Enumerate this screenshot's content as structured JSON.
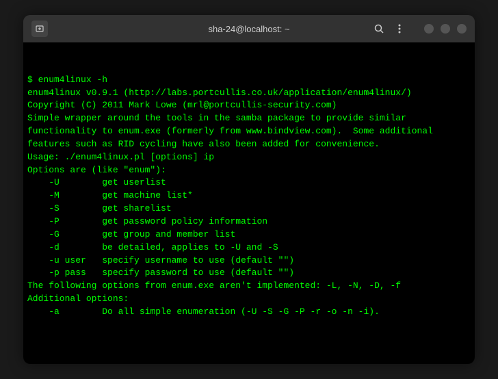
{
  "titlebar": {
    "title": "sha-24@localhost: ~"
  },
  "terminal": {
    "lines": [
      "$ enum4linux -h",
      "enum4linux v0.9.1 (http://labs.portcullis.co.uk/application/enum4linux/)",
      "Copyright (C) 2011 Mark Lowe (mrl@portcullis-security.com)",
      "",
      "Simple wrapper around the tools in the samba package to provide similar",
      "functionality to enum.exe (formerly from www.bindview.com).  Some additional",
      "features such as RID cycling have also been added for convenience.",
      "",
      "Usage: ./enum4linux.pl [options] ip",
      "",
      "Options are (like \"enum\"):",
      "    -U        get userlist",
      "    -M        get machine list*",
      "    -S        get sharelist",
      "    -P        get password policy information",
      "    -G        get group and member list",
      "    -d        be detailed, applies to -U and -S",
      "    -u user   specify username to use (default \"\")",
      "    -p pass   specify password to use (default \"\")",
      "",
      "The following options from enum.exe aren't implemented: -L, -N, -D, -f",
      "",
      "Additional options:",
      "    -a        Do all simple enumeration (-U -S -G -P -r -o -n -i)."
    ]
  }
}
